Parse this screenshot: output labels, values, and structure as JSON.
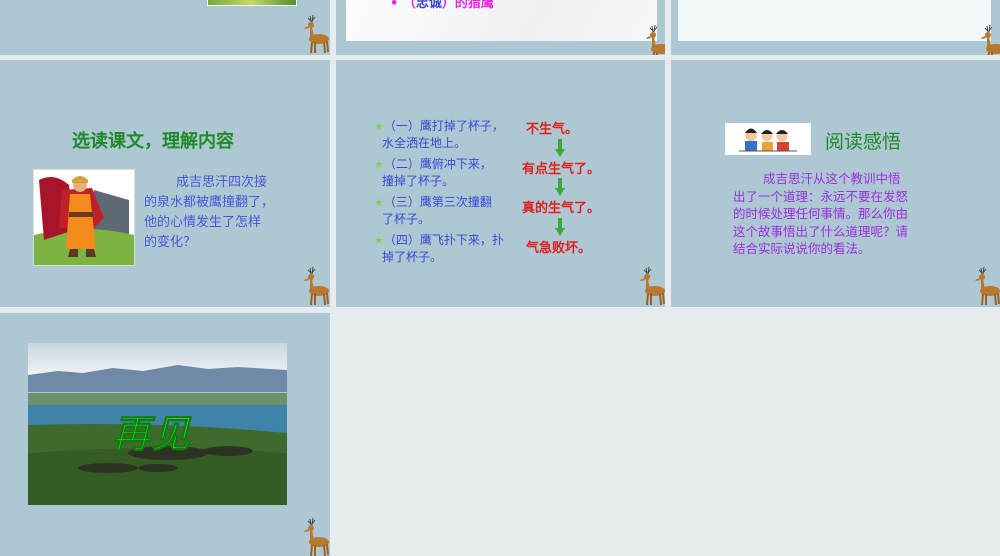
{
  "slides": [
    {
      "id": "top-left"
    },
    {
      "id": "top-middle",
      "bullet_prefix": "（",
      "bullet_blue": "忠诚",
      "bullet_suffix": "）的猎鹰"
    },
    {
      "id": "top-right"
    },
    {
      "id": "choose-text",
      "title": "选读课文，理解内容",
      "paragraph": [
        "成吉思汗四次接",
        "的泉水都被鹰撞翻了，",
        "他的心情发生了怎样",
        "的变化？"
      ]
    },
    {
      "id": "mood-changes",
      "events": [
        {
          "line1": "（一）鹰打掉了杯子，",
          "line2": "水全洒在地上。"
        },
        {
          "line1": "（二）鹰俯冲下来，",
          "line2": "撞掉了杯子。"
        },
        {
          "line1": "（三）鹰第三次撞翻",
          "line2": "了杯子。"
        },
        {
          "line1": "（四）鹰飞扑下来，扑",
          "line2": "掉了杯子。"
        }
      ],
      "moods": [
        "不生气。",
        "有点生气了。",
        "真的生气了。",
        "气急败坏。"
      ]
    },
    {
      "id": "reading-insight",
      "title": "阅读感悟",
      "paragraph": [
        "成吉思汗从这个教训中悟",
        "出了一个道理：永远不要在发怒",
        "的时候处理任何事情。那么你由",
        "这个故事悟出了什么道理呢？请",
        "结合实际说说你的看法。"
      ]
    },
    {
      "id": "goodbye",
      "title": "再见"
    }
  ],
  "colors": {
    "slide_bg": "#aec8d3",
    "title_green": "#1f8a2a",
    "mood_red": "#e0201c",
    "event_blue": "#3b46d6",
    "insight_purple": "#9a2ee0"
  }
}
